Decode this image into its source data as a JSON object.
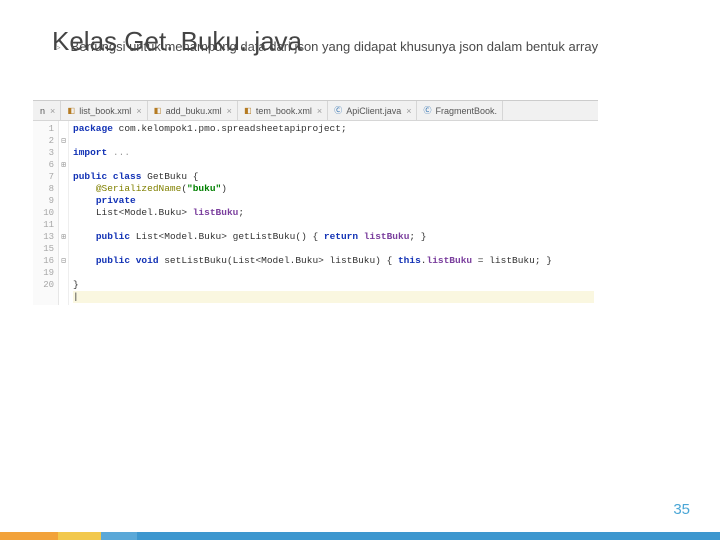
{
  "title": "Kelas Get. Buku. java",
  "bullet_marker": "▹",
  "description": "Berfungsi untuk menampung data dari json yang didapat khusunya json dalam bentuk array",
  "tabs": {
    "t0_suffix": "n",
    "t1": "list_book.xml",
    "t2": "add_buku.xml",
    "t3": "tem_book.xml",
    "t4": "ApiClient.java",
    "t5": "FragmentBook.",
    "close": "×"
  },
  "gutter": [
    "1",
    "2",
    "3",
    "6",
    "7",
    "8",
    "9",
    "10",
    "11",
    "13",
    "15",
    "16",
    "19",
    "20"
  ],
  "fold": {
    "l2": "⊟",
    "l6": "⊞",
    "l10": "⊞",
    "l13": "⊟"
  },
  "code": {
    "l1": {
      "kw": "package",
      "rest": " com.kelompok1.pmo.spreadsheetapiproject;"
    },
    "l3": {
      "kw": "import",
      "mute": " ..."
    },
    "l5": {
      "kw1": "public class",
      "name": " GetBuku {"
    },
    "l6": {
      "ann": "@SerializedName",
      "paren": "(",
      "str": "\"buku\"",
      "close": ")"
    },
    "l7": {
      "kw": "private"
    },
    "l8": {
      "type": "List<Model.Buku> ",
      "fld": "listBuku",
      ";": ";"
    },
    "l10": {
      "kw1": "public ",
      "type": "List<Model.Buku> ",
      "name": "getListBuku() { ",
      "kw2": "return ",
      "fld": "listBuku",
      "end": "; }"
    },
    "l12": {
      "kw1": "public void ",
      "name": "setListBuku(List<Model.Buku> listBuku) { ",
      "kw2": "this",
      "dot": ".",
      "fld": "listBuku",
      "eq": " = listBuku; }"
    },
    "l14": "}",
    "l15": "|"
  },
  "page_number": "35"
}
